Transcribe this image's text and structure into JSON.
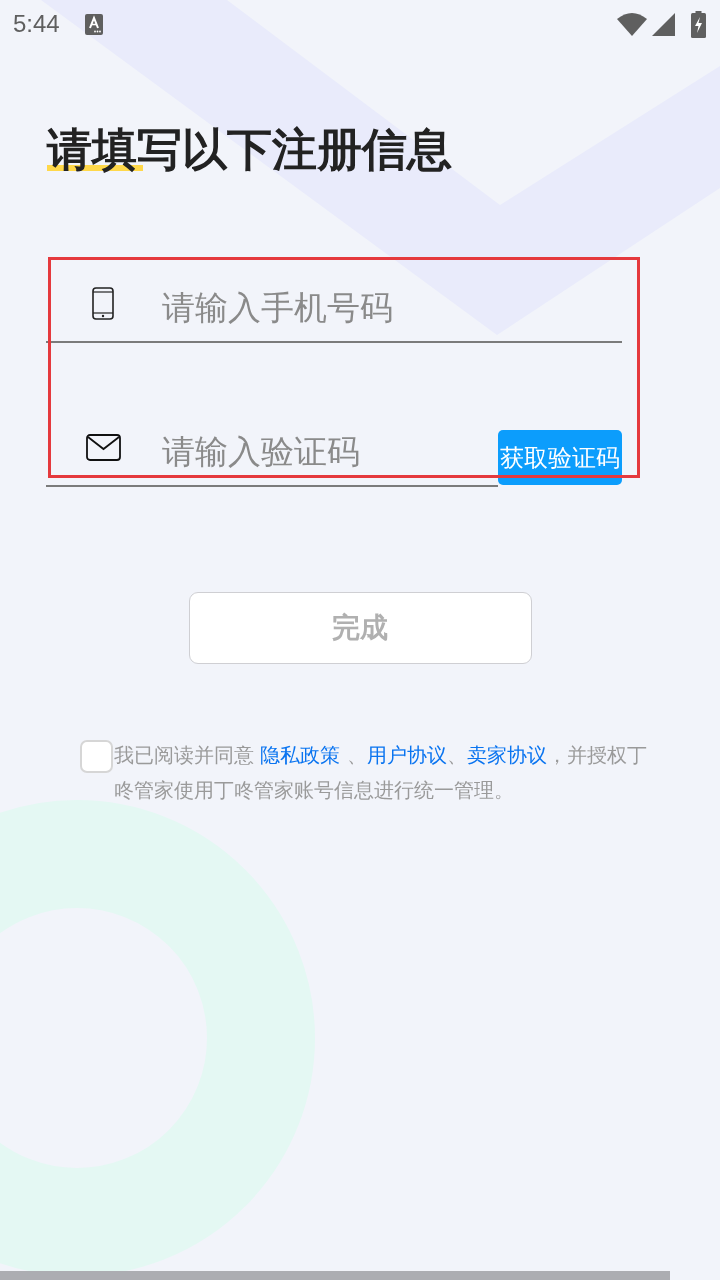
{
  "status_bar": {
    "time": "5:44"
  },
  "title": "请填写以下注册信息",
  "form": {
    "highlighted": true,
    "fields": [
      {
        "kind": "phone",
        "placeholder": "请输入手机号码"
      },
      {
        "kind": "code",
        "placeholder": "请输入验证码",
        "button": "获取验证码"
      }
    ]
  },
  "submit": {
    "label": "完成",
    "disabled": true
  },
  "agreement": {
    "checked": false,
    "parts": [
      {
        "kind": "text",
        "text": "我已阅读并同意 "
      },
      {
        "kind": "link",
        "text": "隐私政策"
      },
      {
        "kind": "text",
        "text": " 、"
      },
      {
        "kind": "link",
        "text": "用户协议"
      },
      {
        "kind": "text",
        "text": "、"
      },
      {
        "kind": "link",
        "text": "卖家协议"
      },
      {
        "kind": "text",
        "text": "，并授权丁咚管家使用丁咚管家账号信息进行统一管理。"
      }
    ]
  }
}
